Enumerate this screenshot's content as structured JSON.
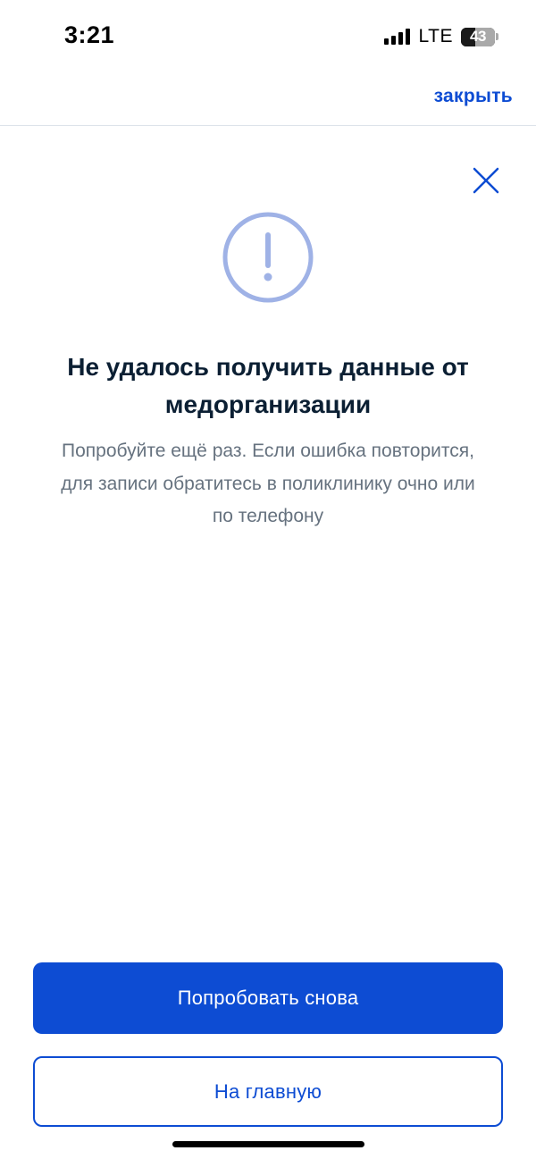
{
  "status_bar": {
    "time": "3:21",
    "network": "LTE",
    "battery_level": "43",
    "battery_fraction": 0.43
  },
  "header": {
    "close_link": "закрыть"
  },
  "icons": {
    "close": "close-icon",
    "warning": "exclamation-circle-icon"
  },
  "error": {
    "title": "Не удалось получить данные от медорганизации",
    "description": "Попробуйте ещё раз. Если ошибка повторится, для записи обратитесь в поликлинику очно или по телефону"
  },
  "actions": {
    "retry_label": "Попробовать снова",
    "home_label": "На главную"
  },
  "colors": {
    "accent": "#0d4cd3",
    "warning_icon": "#9fb2e6",
    "title": "#0b1f33",
    "description": "#66727f",
    "divider": "#dde3ea"
  }
}
